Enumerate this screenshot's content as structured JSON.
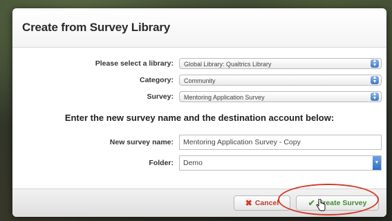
{
  "dialog": {
    "title": "Create from Survey Library"
  },
  "form": {
    "library_label": "Please select a library:",
    "library_value": "Global Library: Qualtrics Library",
    "category_label": "Category:",
    "category_value": "Community",
    "survey_label": "Survey:",
    "survey_value": "Mentoring Application Survey",
    "instruction": "Enter the new survey name and the destination account below:",
    "name_label": "New survey name:",
    "name_value": "Mentoring Application Survey - Copy",
    "folder_label": "Folder:",
    "folder_value": "Demo"
  },
  "footer": {
    "cancel_label": "Cancel",
    "create_label": "Create Survey"
  },
  "icons": {
    "cancel": "x-icon",
    "create": "check-icon",
    "select_spinner": "updown-arrows-icon",
    "folder_dropdown": "chevron-down-icon",
    "cursor": "hand-pointer-icon"
  },
  "colors": {
    "highlight": "#d23a2a",
    "select_accent": "#3b78c4",
    "create_text": "#3d8c2f",
    "cancel_text": "#c0392b"
  }
}
